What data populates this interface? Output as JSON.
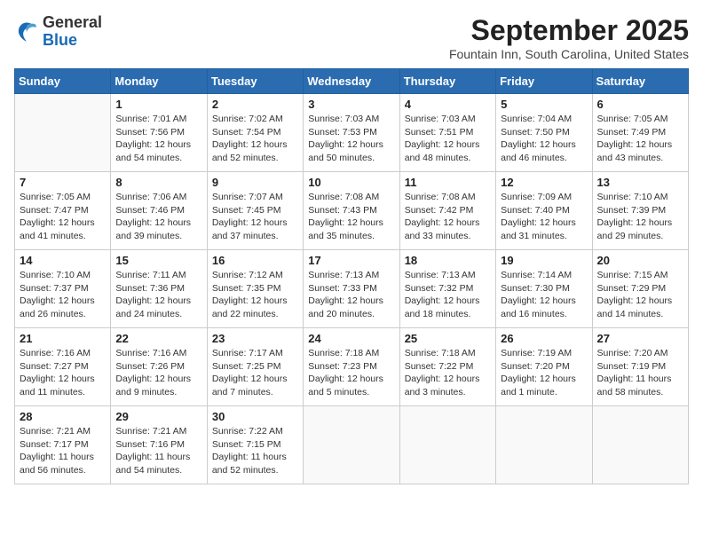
{
  "header": {
    "logo_general": "General",
    "logo_blue": "Blue",
    "month_year": "September 2025",
    "location": "Fountain Inn, South Carolina, United States"
  },
  "weekdays": [
    "Sunday",
    "Monday",
    "Tuesday",
    "Wednesday",
    "Thursday",
    "Friday",
    "Saturday"
  ],
  "weeks": [
    [
      {
        "day": "",
        "info": ""
      },
      {
        "day": "1",
        "info": "Sunrise: 7:01 AM\nSunset: 7:56 PM\nDaylight: 12 hours\nand 54 minutes."
      },
      {
        "day": "2",
        "info": "Sunrise: 7:02 AM\nSunset: 7:54 PM\nDaylight: 12 hours\nand 52 minutes."
      },
      {
        "day": "3",
        "info": "Sunrise: 7:03 AM\nSunset: 7:53 PM\nDaylight: 12 hours\nand 50 minutes."
      },
      {
        "day": "4",
        "info": "Sunrise: 7:03 AM\nSunset: 7:51 PM\nDaylight: 12 hours\nand 48 minutes."
      },
      {
        "day": "5",
        "info": "Sunrise: 7:04 AM\nSunset: 7:50 PM\nDaylight: 12 hours\nand 46 minutes."
      },
      {
        "day": "6",
        "info": "Sunrise: 7:05 AM\nSunset: 7:49 PM\nDaylight: 12 hours\nand 43 minutes."
      }
    ],
    [
      {
        "day": "7",
        "info": "Sunrise: 7:05 AM\nSunset: 7:47 PM\nDaylight: 12 hours\nand 41 minutes."
      },
      {
        "day": "8",
        "info": "Sunrise: 7:06 AM\nSunset: 7:46 PM\nDaylight: 12 hours\nand 39 minutes."
      },
      {
        "day": "9",
        "info": "Sunrise: 7:07 AM\nSunset: 7:45 PM\nDaylight: 12 hours\nand 37 minutes."
      },
      {
        "day": "10",
        "info": "Sunrise: 7:08 AM\nSunset: 7:43 PM\nDaylight: 12 hours\nand 35 minutes."
      },
      {
        "day": "11",
        "info": "Sunrise: 7:08 AM\nSunset: 7:42 PM\nDaylight: 12 hours\nand 33 minutes."
      },
      {
        "day": "12",
        "info": "Sunrise: 7:09 AM\nSunset: 7:40 PM\nDaylight: 12 hours\nand 31 minutes."
      },
      {
        "day": "13",
        "info": "Sunrise: 7:10 AM\nSunset: 7:39 PM\nDaylight: 12 hours\nand 29 minutes."
      }
    ],
    [
      {
        "day": "14",
        "info": "Sunrise: 7:10 AM\nSunset: 7:37 PM\nDaylight: 12 hours\nand 26 minutes."
      },
      {
        "day": "15",
        "info": "Sunrise: 7:11 AM\nSunset: 7:36 PM\nDaylight: 12 hours\nand 24 minutes."
      },
      {
        "day": "16",
        "info": "Sunrise: 7:12 AM\nSunset: 7:35 PM\nDaylight: 12 hours\nand 22 minutes."
      },
      {
        "day": "17",
        "info": "Sunrise: 7:13 AM\nSunset: 7:33 PM\nDaylight: 12 hours\nand 20 minutes."
      },
      {
        "day": "18",
        "info": "Sunrise: 7:13 AM\nSunset: 7:32 PM\nDaylight: 12 hours\nand 18 minutes."
      },
      {
        "day": "19",
        "info": "Sunrise: 7:14 AM\nSunset: 7:30 PM\nDaylight: 12 hours\nand 16 minutes."
      },
      {
        "day": "20",
        "info": "Sunrise: 7:15 AM\nSunset: 7:29 PM\nDaylight: 12 hours\nand 14 minutes."
      }
    ],
    [
      {
        "day": "21",
        "info": "Sunrise: 7:16 AM\nSunset: 7:27 PM\nDaylight: 12 hours\nand 11 minutes."
      },
      {
        "day": "22",
        "info": "Sunrise: 7:16 AM\nSunset: 7:26 PM\nDaylight: 12 hours\nand 9 minutes."
      },
      {
        "day": "23",
        "info": "Sunrise: 7:17 AM\nSunset: 7:25 PM\nDaylight: 12 hours\nand 7 minutes."
      },
      {
        "day": "24",
        "info": "Sunrise: 7:18 AM\nSunset: 7:23 PM\nDaylight: 12 hours\nand 5 minutes."
      },
      {
        "day": "25",
        "info": "Sunrise: 7:18 AM\nSunset: 7:22 PM\nDaylight: 12 hours\nand 3 minutes."
      },
      {
        "day": "26",
        "info": "Sunrise: 7:19 AM\nSunset: 7:20 PM\nDaylight: 12 hours\nand 1 minute."
      },
      {
        "day": "27",
        "info": "Sunrise: 7:20 AM\nSunset: 7:19 PM\nDaylight: 11 hours\nand 58 minutes."
      }
    ],
    [
      {
        "day": "28",
        "info": "Sunrise: 7:21 AM\nSunset: 7:17 PM\nDaylight: 11 hours\nand 56 minutes."
      },
      {
        "day": "29",
        "info": "Sunrise: 7:21 AM\nSunset: 7:16 PM\nDaylight: 11 hours\nand 54 minutes."
      },
      {
        "day": "30",
        "info": "Sunrise: 7:22 AM\nSunset: 7:15 PM\nDaylight: 11 hours\nand 52 minutes."
      },
      {
        "day": "",
        "info": ""
      },
      {
        "day": "",
        "info": ""
      },
      {
        "day": "",
        "info": ""
      },
      {
        "day": "",
        "info": ""
      }
    ]
  ]
}
